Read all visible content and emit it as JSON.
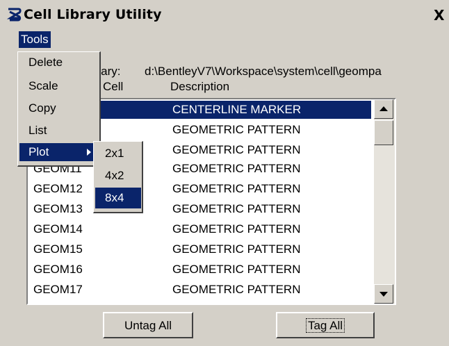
{
  "window": {
    "title": "Cell Library Utility",
    "close_label": "X"
  },
  "menubar": {
    "tools_label": "Tools"
  },
  "library": {
    "label": "brary:",
    "path": "d:\\BentleyV7\\Workspace\\system\\cell\\geompa"
  },
  "columns": {
    "cell": "Cell",
    "description": "Description"
  },
  "rows": [
    {
      "cell": "",
      "description": "CENTERLINE MARKER",
      "selected": true
    },
    {
      "cell": "",
      "description": "GEOMETRIC PATTERN"
    },
    {
      "cell": "",
      "description": "GEOMETRIC PATTERN"
    },
    {
      "cell": "GEOM11",
      "description": "GEOMETRIC PATTERN"
    },
    {
      "cell": "GEOM12",
      "description": "GEOMETRIC PATTERN"
    },
    {
      "cell": "GEOM13",
      "description": "GEOMETRIC PATTERN"
    },
    {
      "cell": "GEOM14",
      "description": "GEOMETRIC PATTERN"
    },
    {
      "cell": "GEOM15",
      "description": "GEOMETRIC PATTERN"
    },
    {
      "cell": "GEOM16",
      "description": "GEOMETRIC PATTERN"
    },
    {
      "cell": "GEOM17",
      "description": "GEOMETRIC PATTERN"
    }
  ],
  "buttons": {
    "untag_all": "Untag All",
    "tag_all": "Tag All"
  },
  "tools_menu": {
    "items": [
      {
        "label": "Delete"
      },
      {
        "label": "Scale"
      },
      {
        "label": "Copy"
      },
      {
        "label": "List"
      },
      {
        "label": "Plot",
        "highlighted": true,
        "submenu": true
      }
    ]
  },
  "plot_submenu": {
    "items": [
      {
        "label": "2x1"
      },
      {
        "label": "4x2"
      },
      {
        "label": "8x4",
        "highlighted": true
      }
    ]
  },
  "colors": {
    "selection": "#0a246a",
    "face": "#d4d0c8",
    "list_bg": "#ffffff"
  },
  "icons": {
    "app": "bentley-logo-icon",
    "scroll_up": "arrow-up-icon",
    "scroll_down": "arrow-down-icon",
    "submenu": "arrow-right-icon"
  }
}
